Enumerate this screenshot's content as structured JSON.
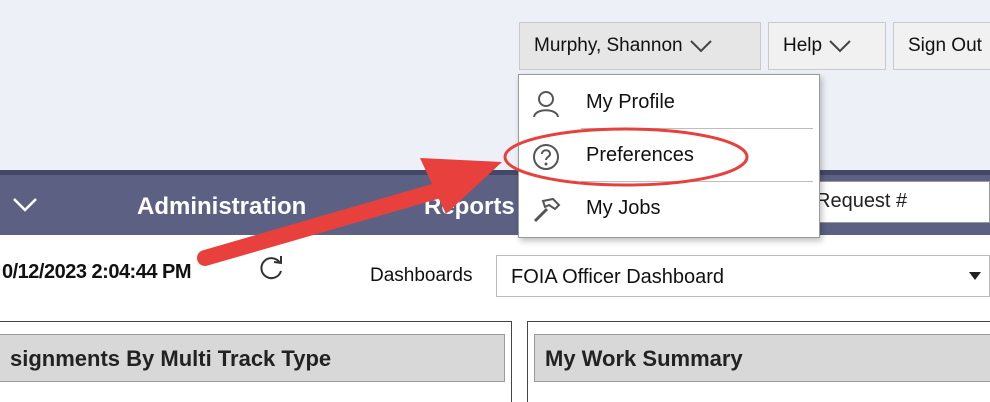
{
  "header": {
    "user_menu_label": "Murphy, Shannon",
    "help_label": "Help",
    "sign_out_label": "Sign Out"
  },
  "user_dropdown": {
    "items": [
      {
        "label": "My Profile",
        "icon": "user-icon"
      },
      {
        "label": "Preferences",
        "icon": "question-circle-icon"
      },
      {
        "label": "My Jobs",
        "icon": "hammer-icon"
      }
    ]
  },
  "nav": {
    "administration_label": "Administration",
    "reports_label": "Reports"
  },
  "search": {
    "value": "Request #"
  },
  "dashboard": {
    "timestamp": "0/12/2023 2:04:44 PM",
    "dashboards_label": "Dashboards",
    "selected_dashboard": "FOIA Officer Dashboard"
  },
  "panels": {
    "left_title": "signments By Multi Track Type",
    "right_title": "My Work Summary"
  },
  "colors": {
    "nav_bar": "#5c6183",
    "annotation_red": "#e8403c",
    "top_bar": "#eef0f8"
  }
}
